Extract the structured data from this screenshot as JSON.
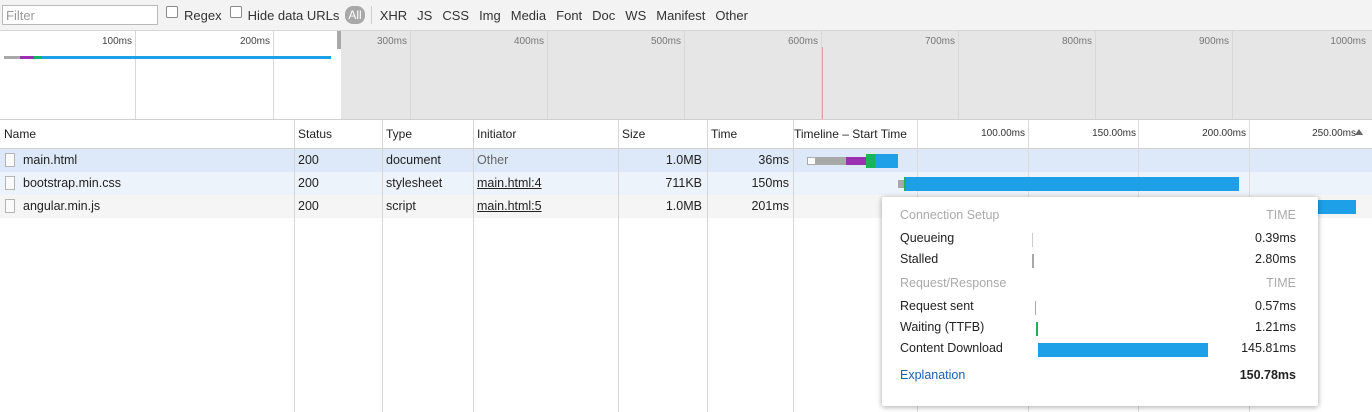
{
  "toolbar": {
    "filter_placeholder": "Filter",
    "regex_label": "Regex",
    "hide_data_urls_label": "Hide data URLs",
    "types": [
      "All",
      "XHR",
      "JS",
      "CSS",
      "Img",
      "Media",
      "Font",
      "Doc",
      "WS",
      "Manifest",
      "Other"
    ]
  },
  "overview": {
    "ticks": [
      "100ms",
      "200ms",
      "300ms",
      "400ms",
      "500ms",
      "600ms",
      "700ms",
      "800ms",
      "900ms",
      "1000ms"
    ]
  },
  "table": {
    "headers": {
      "name": "Name",
      "status": "Status",
      "type": "Type",
      "initiator": "Initiator",
      "size": "Size",
      "time": "Time",
      "timeline": "Timeline – Start Time"
    },
    "timeline_ticks": [
      "100.00ms",
      "150.00ms",
      "200.00ms",
      "250.00ms"
    ],
    "rows": [
      {
        "name": "main.html",
        "status": "200",
        "type": "document",
        "initiator": "Other",
        "size": "1.0MB",
        "time": "36ms"
      },
      {
        "name": "bootstrap.min.css",
        "status": "200",
        "type": "stylesheet",
        "initiator": "main.html:4",
        "size": "711KB",
        "time": "150ms"
      },
      {
        "name": "angular.min.js",
        "status": "200",
        "type": "script",
        "initiator": "main.html:5",
        "size": "1.0MB",
        "time": "201ms"
      }
    ]
  },
  "tooltip": {
    "connection_header": "Connection Setup",
    "time_header": "TIME",
    "connection": [
      {
        "label": "Queueing",
        "value": "0.39ms"
      },
      {
        "label": "Stalled",
        "value": "2.80ms"
      }
    ],
    "request_header": "Request/Response",
    "request": [
      {
        "label": "Request sent",
        "value": "0.57ms"
      },
      {
        "label": "Waiting (TTFB)",
        "value": "1.21ms"
      },
      {
        "label": "Content Download",
        "value": "145.81ms"
      }
    ],
    "explanation_label": "Explanation",
    "total": "150.78ms"
  },
  "colors": {
    "download": "#1ea0e8",
    "waiting": "#1bb35a",
    "stalled": "#a8a8a8",
    "ssl": "#9b30b0",
    "selected_row": "#dde9f8"
  }
}
